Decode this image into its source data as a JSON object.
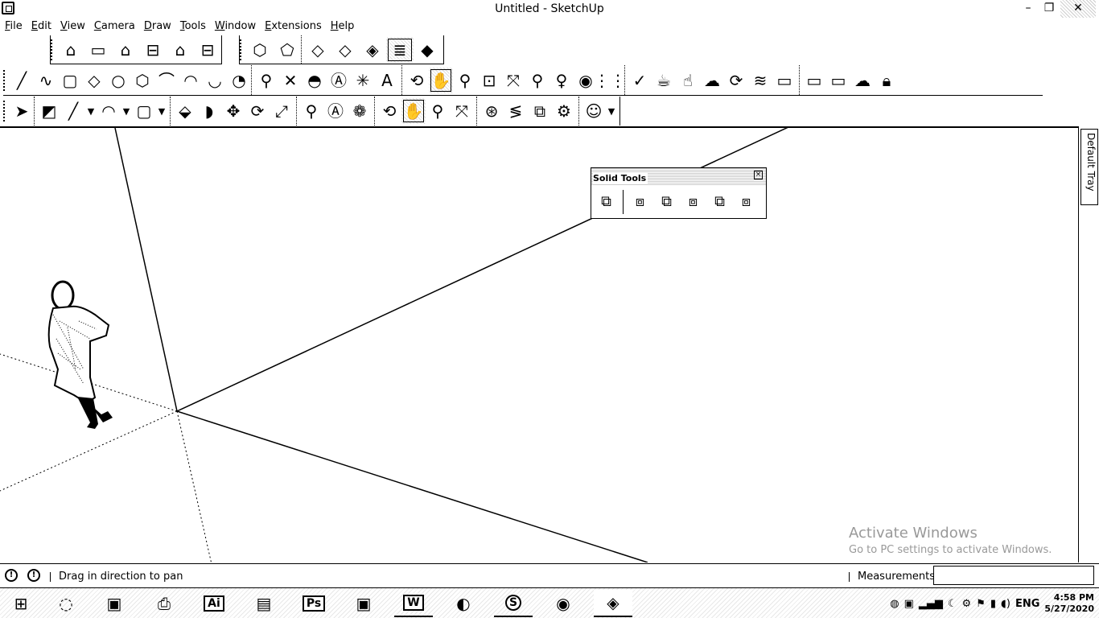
{
  "window": {
    "title": "Untitled - SketchUp",
    "minimize": "–",
    "restore": "❐",
    "close": "✕"
  },
  "menu": [
    "File",
    "Edit",
    "View",
    "Camera",
    "Draw",
    "Tools",
    "Window",
    "Extensions",
    "Help"
  ],
  "tray_tab_label": "Default Tray",
  "solid_tools": {
    "title": "Solid Tools",
    "close": "×"
  },
  "watermark": {
    "title": "Activate Windows",
    "subtitle": "Go to PC settings to activate Windows."
  },
  "status": {
    "message": "Drag in direction to pan",
    "measurements_label": "Measurements",
    "measurements_value": ""
  },
  "taskbar": {
    "apps": [
      {
        "name": "start",
        "glyph": "⊞"
      },
      {
        "name": "edge",
        "glyph": "◌"
      },
      {
        "name": "outlook",
        "glyph": "▣"
      },
      {
        "name": "printer",
        "glyph": "⎙"
      },
      {
        "name": "illustrator",
        "glyph": "Ai"
      },
      {
        "name": "word-doc",
        "glyph": "▤"
      },
      {
        "name": "photoshop",
        "glyph": "Ps"
      },
      {
        "name": "outlook-2",
        "glyph": "▣"
      },
      {
        "name": "word",
        "glyph": "W"
      },
      {
        "name": "chrome",
        "glyph": "◐"
      },
      {
        "name": "skype",
        "glyph": "S"
      },
      {
        "name": "media",
        "glyph": "◉"
      },
      {
        "name": "sketchup",
        "glyph": "◈"
      }
    ],
    "tray_lang": "ENG",
    "time": "4:58 PM",
    "date": "5/27/2020"
  },
  "accent_color": "#000000"
}
